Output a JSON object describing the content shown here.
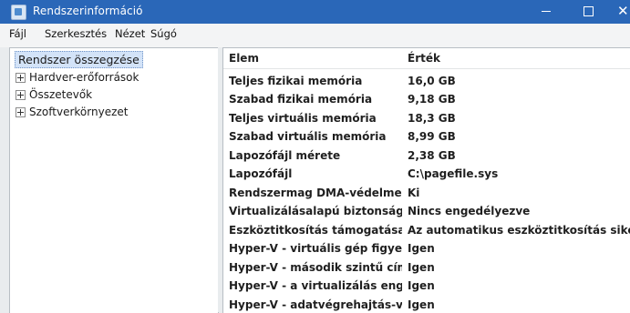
{
  "window": {
    "title": "Rendszerinformáció",
    "icon": "system-info-icon",
    "controls": [
      "minimize-icon",
      "maximize-icon",
      "close-icon"
    ],
    "colors": {
      "titlebar": "#2a67b8",
      "selection": "#d3e3f8"
    }
  },
  "menu": {
    "items": [
      "Fájl",
      "Szerkesztés",
      "Nézet",
      "Súgó"
    ]
  },
  "tree": {
    "selected": "Rendszer összegzése",
    "nodes": [
      "Hardver-erőforrások",
      "Összetevők",
      "Szoftverkörnyezet"
    ]
  },
  "details": {
    "columns": {
      "name": "Elem",
      "value": "Érték"
    },
    "rows": [
      {
        "name": "Teljes fizikai memória",
        "value": "16,0 GB"
      },
      {
        "name": "Szabad fizikai memória",
        "value": "9,18 GB"
      },
      {
        "name": "Teljes virtuális memória",
        "value": "18,3 GB"
      },
      {
        "name": "Szabad virtuális memória",
        "value": "8,99 GB"
      },
      {
        "name": "Lapozófájl mérete",
        "value": "2,38 GB"
      },
      {
        "name": "Lapozófájl",
        "value": "C:\\pagefile.sys"
      },
      {
        "name": "Rendszermag DMA-védelme",
        "value": "Ki"
      },
      {
        "name": "Virtualizálásalapú biztonság",
        "value": "Nincs engedélyezve"
      },
      {
        "name": "Eszköztitkosítás támogatása",
        "value": "Az automatikus eszköztitkosítás sikertelen"
      },
      {
        "name": "Hyper-V - virtuális gép figyelő ...",
        "value": "Igen"
      },
      {
        "name": "Hyper-V - második szintű címfo...",
        "value": "Igen"
      },
      {
        "name": "Hyper-V - a virtualizálás enged...",
        "value": "Igen"
      },
      {
        "name": "Hyper-V - adatvégrehajtás-véd...",
        "value": "Igen"
      }
    ]
  }
}
